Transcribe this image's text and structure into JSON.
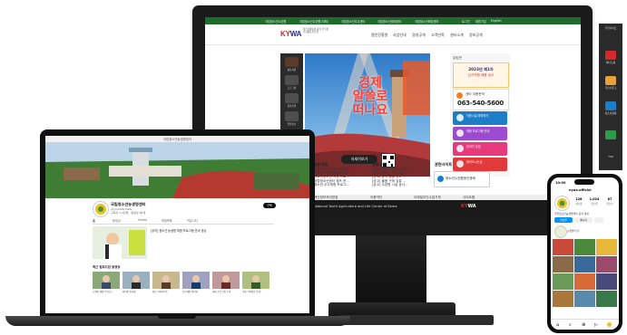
{
  "monitor": {
    "top_links": [
      "국립청소년수련원",
      "국립청소년수련원(미래)",
      "국립청소년우주센터",
      "국립청소년생태센터",
      "국립청소년해양센터"
    ],
    "util_links": [
      "로그인",
      "회원가입",
      "English"
    ],
    "logo": {
      "k": "K",
      "y": "Y",
      "w": "W",
      "a": "A",
      "sub": "청소년활동의 중심 한국청소년활동진흥원"
    },
    "nav": [
      "열린진흥원",
      "사업안내",
      "경영공개",
      "고객만족",
      "센터소개",
      "정보공개"
    ],
    "sidebar": [
      "활동지원",
      "프로그램",
      "통합검색",
      "입찰정보",
      "채용정보"
    ],
    "hero": {
      "headline": "경제\n알쓸로\n떠나요",
      "cta": "자세히보기"
    },
    "right_panel": {
      "tag": "알림판",
      "notice_title": "2023년 제1차",
      "notice_sub": "신규직원 채용 공고",
      "contact_label": "센터 이용문의",
      "phone": "063-540-5600",
      "buttons": [
        "이용시설 예약하기",
        "체험 프로그램 안내",
        "온라인 상담",
        "찾아오시는길"
      ]
    },
    "news_titles": [
      "보도자료",
      "입찰공고",
      "관련사이트"
    ],
    "news_items": [
      [
        "국립청소년수련원 글로벌...",
        "국립청소년 활동정보 제공...",
        "학교밖청소년 지원 프로...",
        "국립청소년센터 캠프 운...",
        "청소년 우주체험 프로그..."
      ],
      [
        "[공고] 2023 시설 유지보수...",
        "[공고] 청소년 프로그램 ...",
        "[공고] 용역 입찰 공고 ...",
        "[공고] 물품 구매 입찰 ...",
        "[공고] 수련원 시설 공사..."
      ]
    ],
    "related_site": "청소년수련활동인증제",
    "footer_links": [
      "개인정보처리방침",
      "이용약관",
      "이메일무단수집거부",
      "사이트맵"
    ],
    "footer_text": "National Youth Agriculture and Life Center of Korea",
    "side_right": [
      "추천사이트",
      "배너모음",
      "국민신문고",
      "청소년활동",
      "TOP"
    ]
  },
  "laptop": {
    "title_bar": "국립청소년농생명센터",
    "channel_name": "국립청소년농생명센터",
    "channel_handle": "@youthfarmlife",
    "channel_meta": "구독자 1.2천명 · 동영상 86개",
    "subscribe": "구독",
    "tabs": [
      "홈",
      "동영상",
      "Shorts",
      "재생목록",
      "커뮤니티"
    ],
    "featured_caption": "[공지] 청소년 농생명 체험 프로그램 안내 영상",
    "section_title": "최근 업로드된 동영상",
    "videos": [
      "농생명 체험 브이로그",
      "센터장 인사말",
      "캠프 하이라이트",
      "진로체험 인터뷰",
      "생태 프로그램 소개",
      "주말 가족캠프 안내"
    ]
  },
  "phone": {
    "time": "10:00",
    "profile_name": "nyaa.official",
    "stats": [
      "게시물",
      "팔로워",
      "팔로잉"
    ],
    "stat_values": [
      "128",
      "1,024",
      "87"
    ],
    "bio": "국립청소년농생명센터 공식 계정",
    "follow": "팔로우",
    "message": "메시지",
    "highlight": "농생명의 날"
  },
  "colors": {
    "green": "#1e6b2c",
    "kywa_red": "#d62a2a",
    "kywa_navy": "#2a2a88",
    "btn_blue": "#1c7ec9",
    "btn_orange": "#ff7a1a",
    "btn_purple": "#9c4ad0",
    "btn_pink": "#e63a7d",
    "btn_red": "#e23a3a",
    "youtube_red": "#ff0000",
    "insta_blue": "#0095f6"
  }
}
